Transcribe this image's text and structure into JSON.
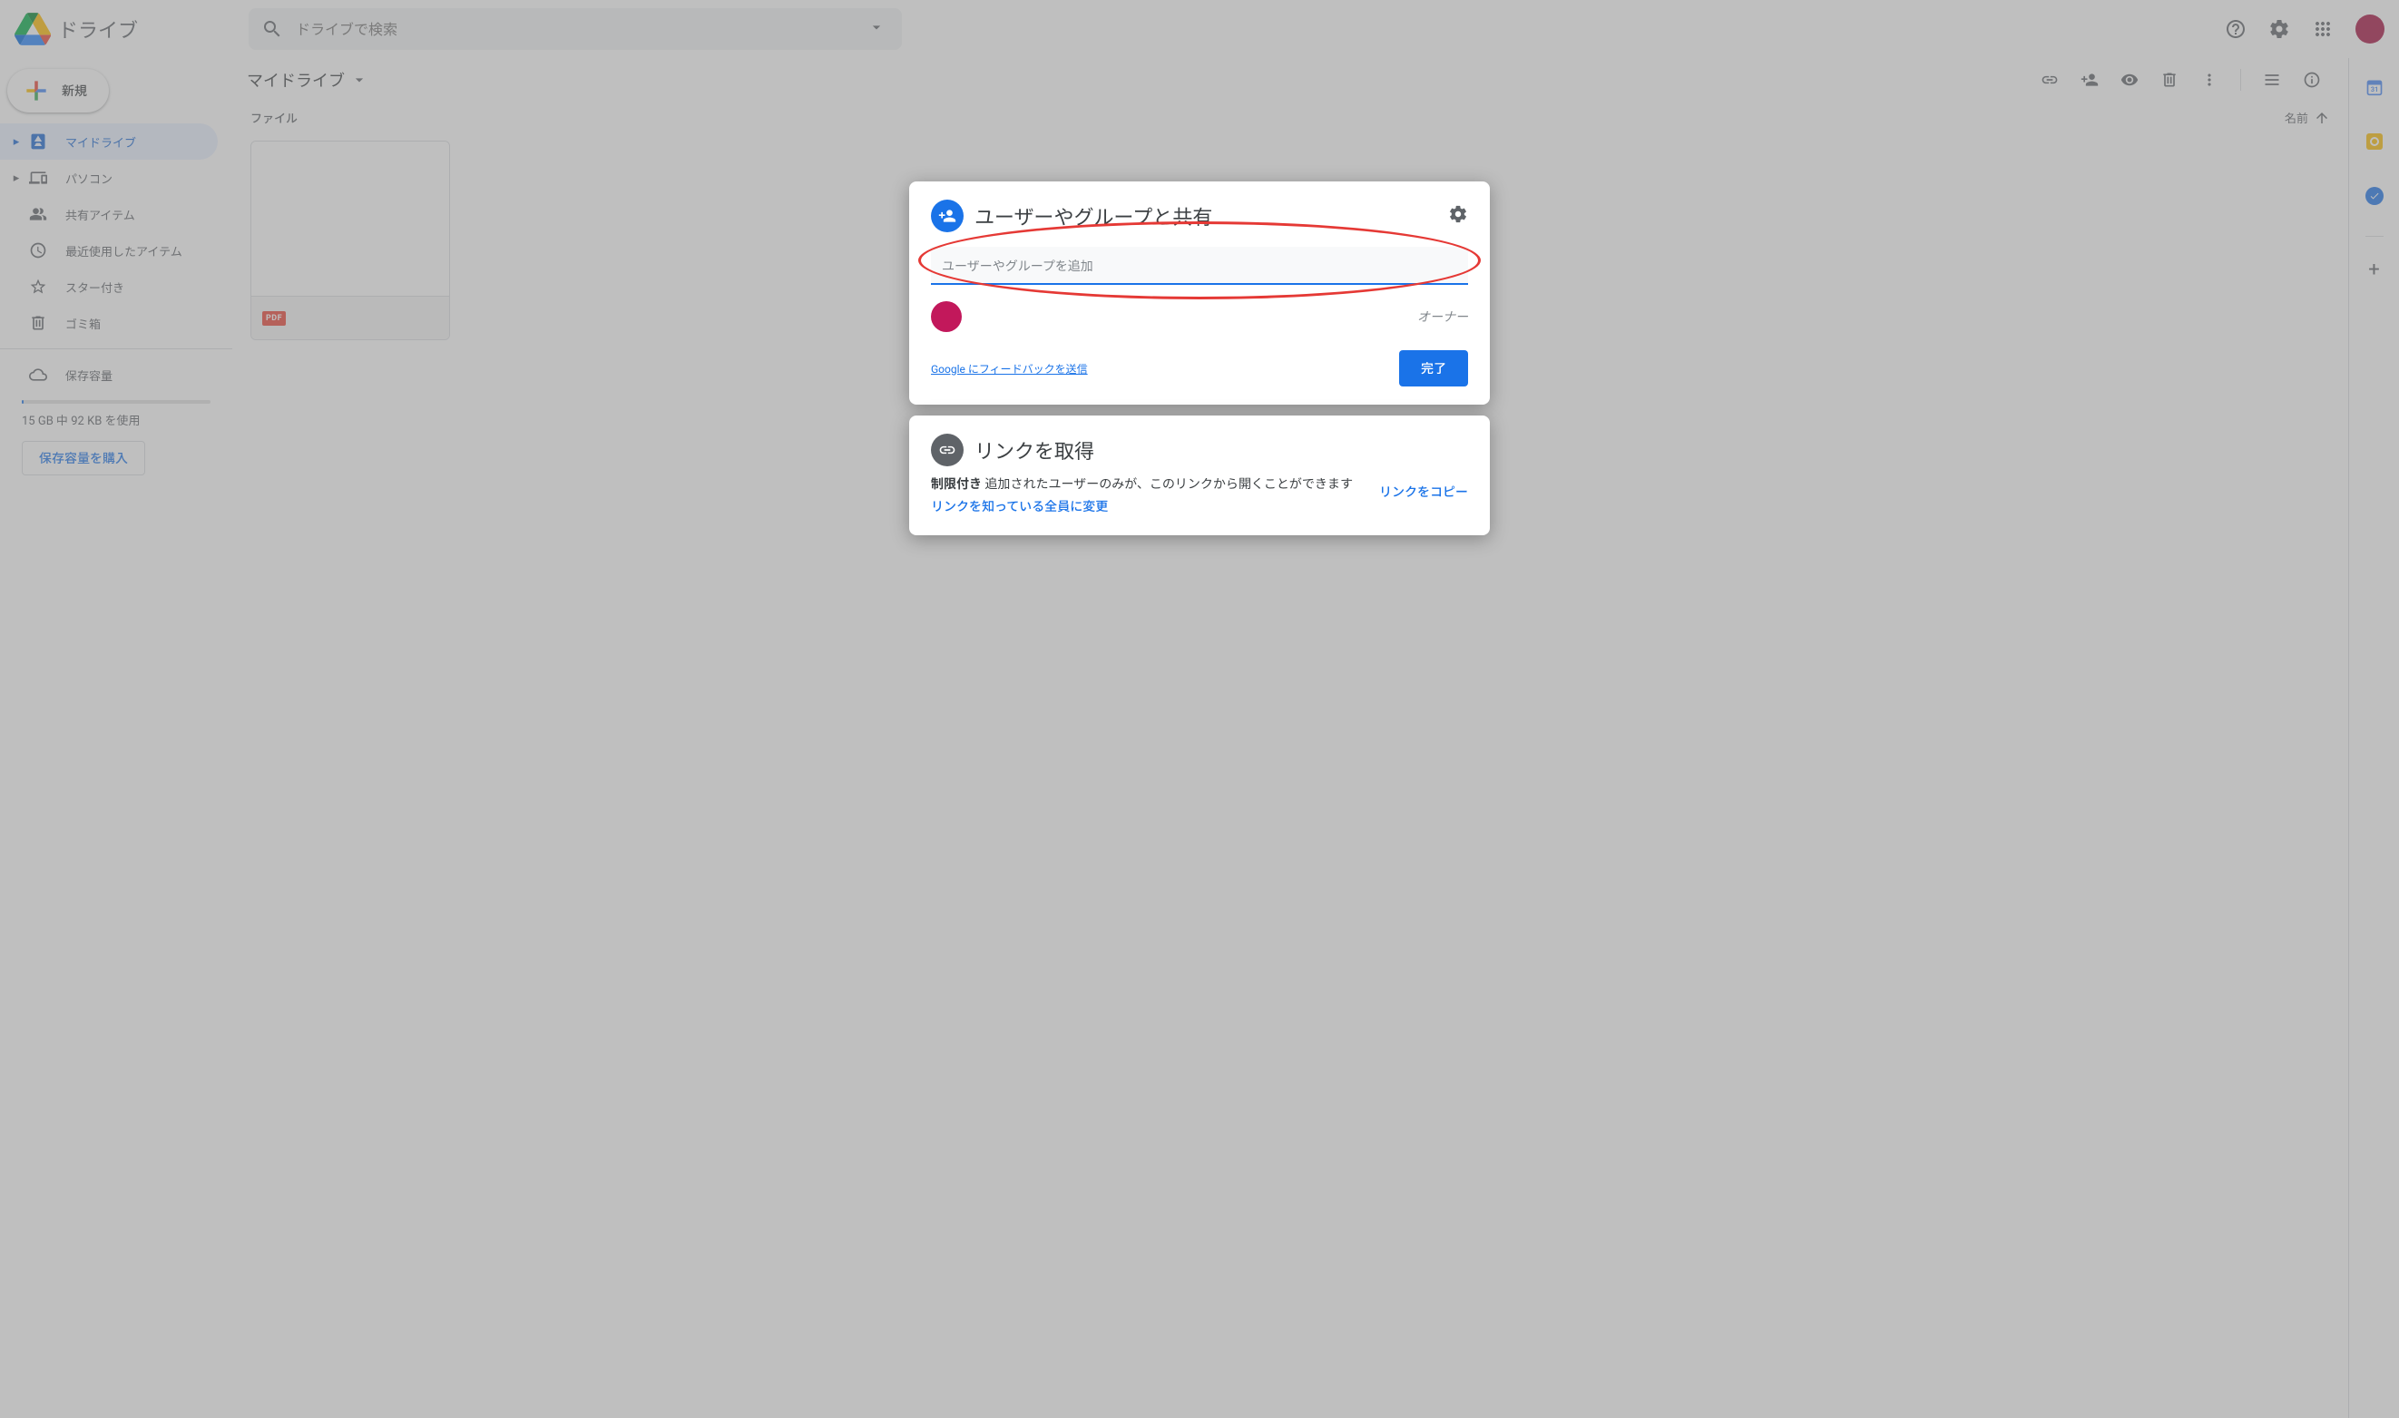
{
  "app": {
    "name": "ドライブ"
  },
  "search": {
    "placeholder": "ドライブで検索"
  },
  "sidebar": {
    "new_label": "新規",
    "items": [
      {
        "label": "マイドライブ"
      },
      {
        "label": "パソコン"
      },
      {
        "label": "共有アイテム"
      },
      {
        "label": "最近使用したアイテム"
      },
      {
        "label": "スター付き"
      },
      {
        "label": "ゴミ箱"
      }
    ],
    "storage_label": "保存容量",
    "storage_used_text": "15 GB 中 92 KB を使用",
    "buy_storage": "保存容量を購入"
  },
  "main": {
    "breadcrumb": "マイドライブ",
    "section_label": "ファイル",
    "sort_label": "名前",
    "file_badge": "PDF"
  },
  "dialog_share": {
    "title": "ユーザーやグループと共有",
    "input_placeholder": "ユーザーやグループを追加",
    "owner_role": "オーナー",
    "feedback": "Google にフィードバックを送信",
    "done": "完了"
  },
  "dialog_link": {
    "title": "リンクを取得",
    "restricted_label": "制限付き",
    "restricted_desc": " 追加されたユーザーのみが、このリンクから開くことができます",
    "copy": "リンクをコピー",
    "change": "リンクを知っている全員に変更"
  }
}
